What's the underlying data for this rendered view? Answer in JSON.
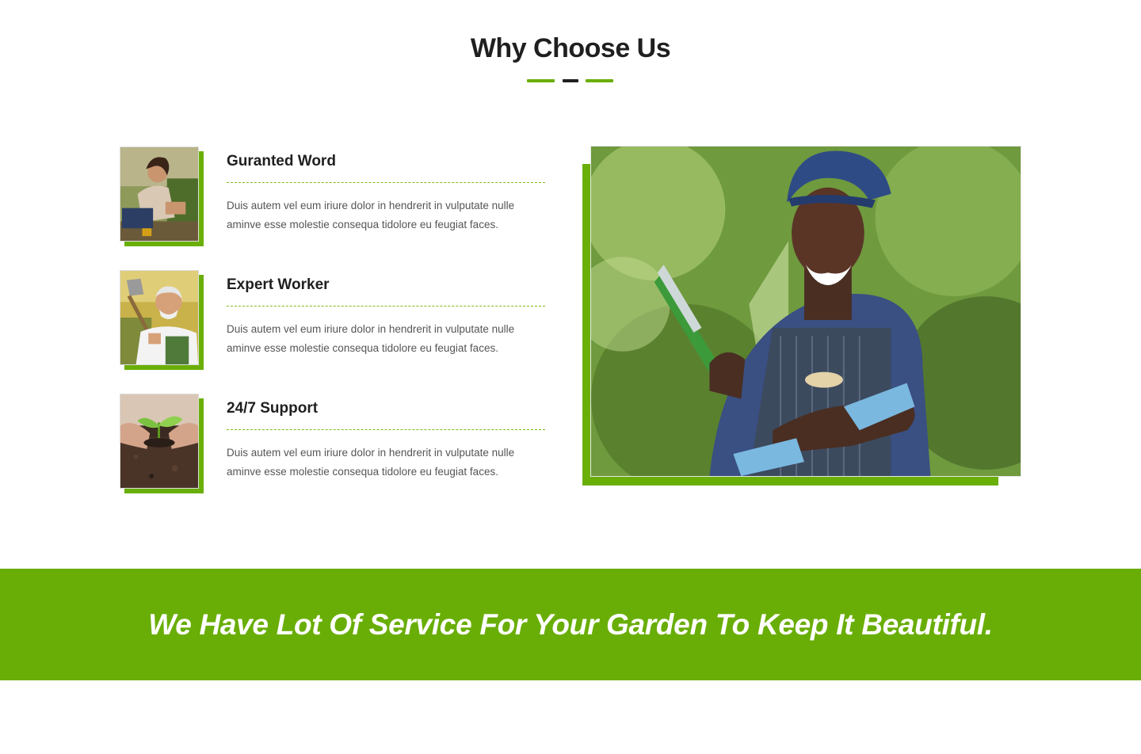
{
  "section": {
    "title": "Why Choose Us"
  },
  "features": [
    {
      "title": "Guranted Word",
      "text": "Duis autem vel eum iriure dolor in hendrerit in vulputate nulle aminve esse molestie consequa tidolore eu feugiat faces."
    },
    {
      "title": "Expert Worker",
      "text": "Duis autem vel eum iriure dolor in hendrerit in vulputate nulle aminve esse molestie consequa tidolore eu feugiat faces."
    },
    {
      "title": "24/7 Support",
      "text": "Duis autem vel eum iriure dolor in hendrerit in vulputate nulle aminve esse molestie consequa tidolore eu feugiat faces."
    }
  ],
  "banner": {
    "text": "We Have Lot Of Service For Your Garden To Keep It Beautiful."
  },
  "colors": {
    "accent": "#6aaf08",
    "heading": "#1f1f1f",
    "body_text": "#555555",
    "banner_bg": "#69ae07"
  }
}
